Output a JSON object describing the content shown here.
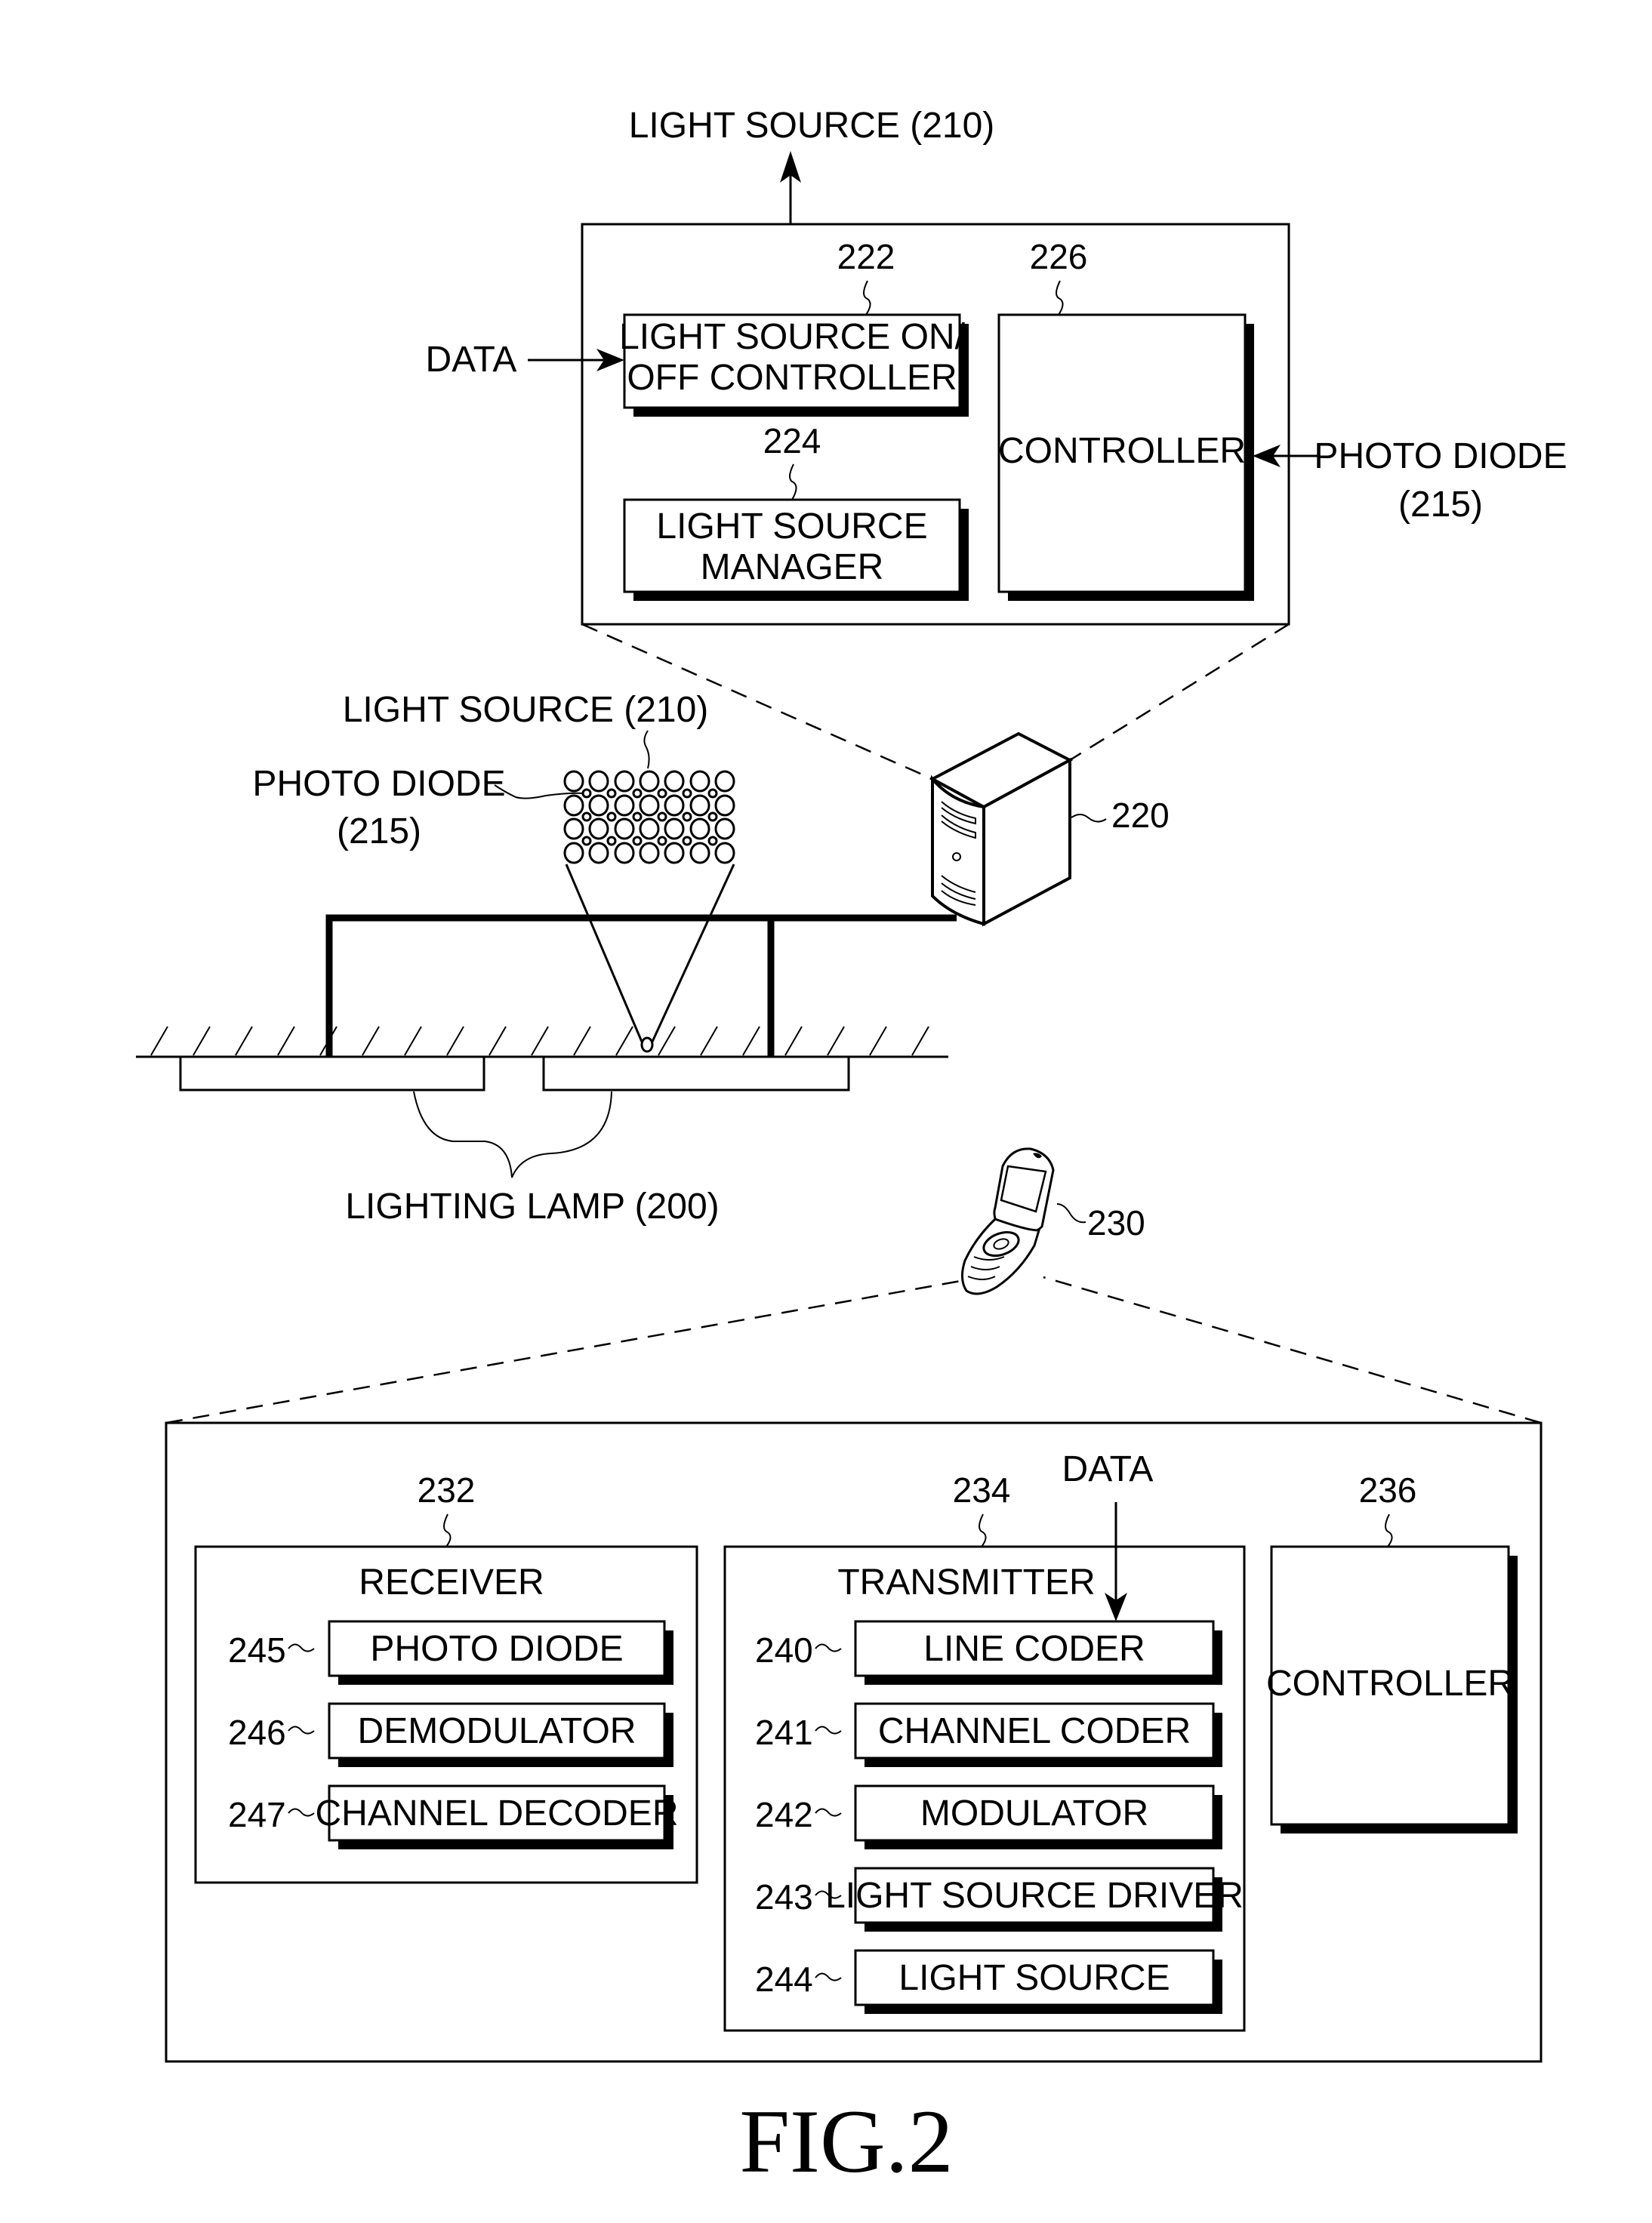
{
  "figure_label": "FIG.2",
  "top_diagram": {
    "output_label": "LIGHT SOURCE (210)",
    "data_input_label": "DATA",
    "photo_diode_label_line1": "PHOTO DIODE",
    "photo_diode_label_line2": "(215)",
    "blocks": {
      "on_off_controller": {
        "ref": "222",
        "line1": "LIGHT SOURCE ON/",
        "line2": "OFF CONTROLLER"
      },
      "manager": {
        "ref": "224",
        "line1": "LIGHT SOURCE",
        "line2": "MANAGER"
      },
      "controller": {
        "ref": "226",
        "label": "CONTROLLER"
      }
    }
  },
  "scene": {
    "light_source_label": "LIGHT SOURCE (210)",
    "photo_diode_line1": "PHOTO DIODE",
    "photo_diode_line2": "(215)",
    "server_ref": "220",
    "lamp_label": "LIGHTING LAMP (200)",
    "phone_ref": "230"
  },
  "terminal": {
    "receiver": {
      "ref": "232",
      "title": "RECEIVER",
      "items": [
        {
          "ref": "245",
          "label": "PHOTO DIODE"
        },
        {
          "ref": "246",
          "label": "DEMODULATOR"
        },
        {
          "ref": "247",
          "label": "CHANNEL DECODER"
        }
      ]
    },
    "transmitter": {
      "ref": "234",
      "title": "TRANSMITTER",
      "data_label": "DATA",
      "items": [
        {
          "ref": "240",
          "label": "LINE CODER"
        },
        {
          "ref": "241",
          "label": "CHANNEL CODER"
        },
        {
          "ref": "242",
          "label": "MODULATOR"
        },
        {
          "ref": "243",
          "label": "LIGHT SOURCE DRIVER"
        },
        {
          "ref": "244",
          "label": "LIGHT SOURCE"
        }
      ]
    },
    "controller": {
      "ref": "236",
      "label": "CONTROLLER"
    }
  }
}
